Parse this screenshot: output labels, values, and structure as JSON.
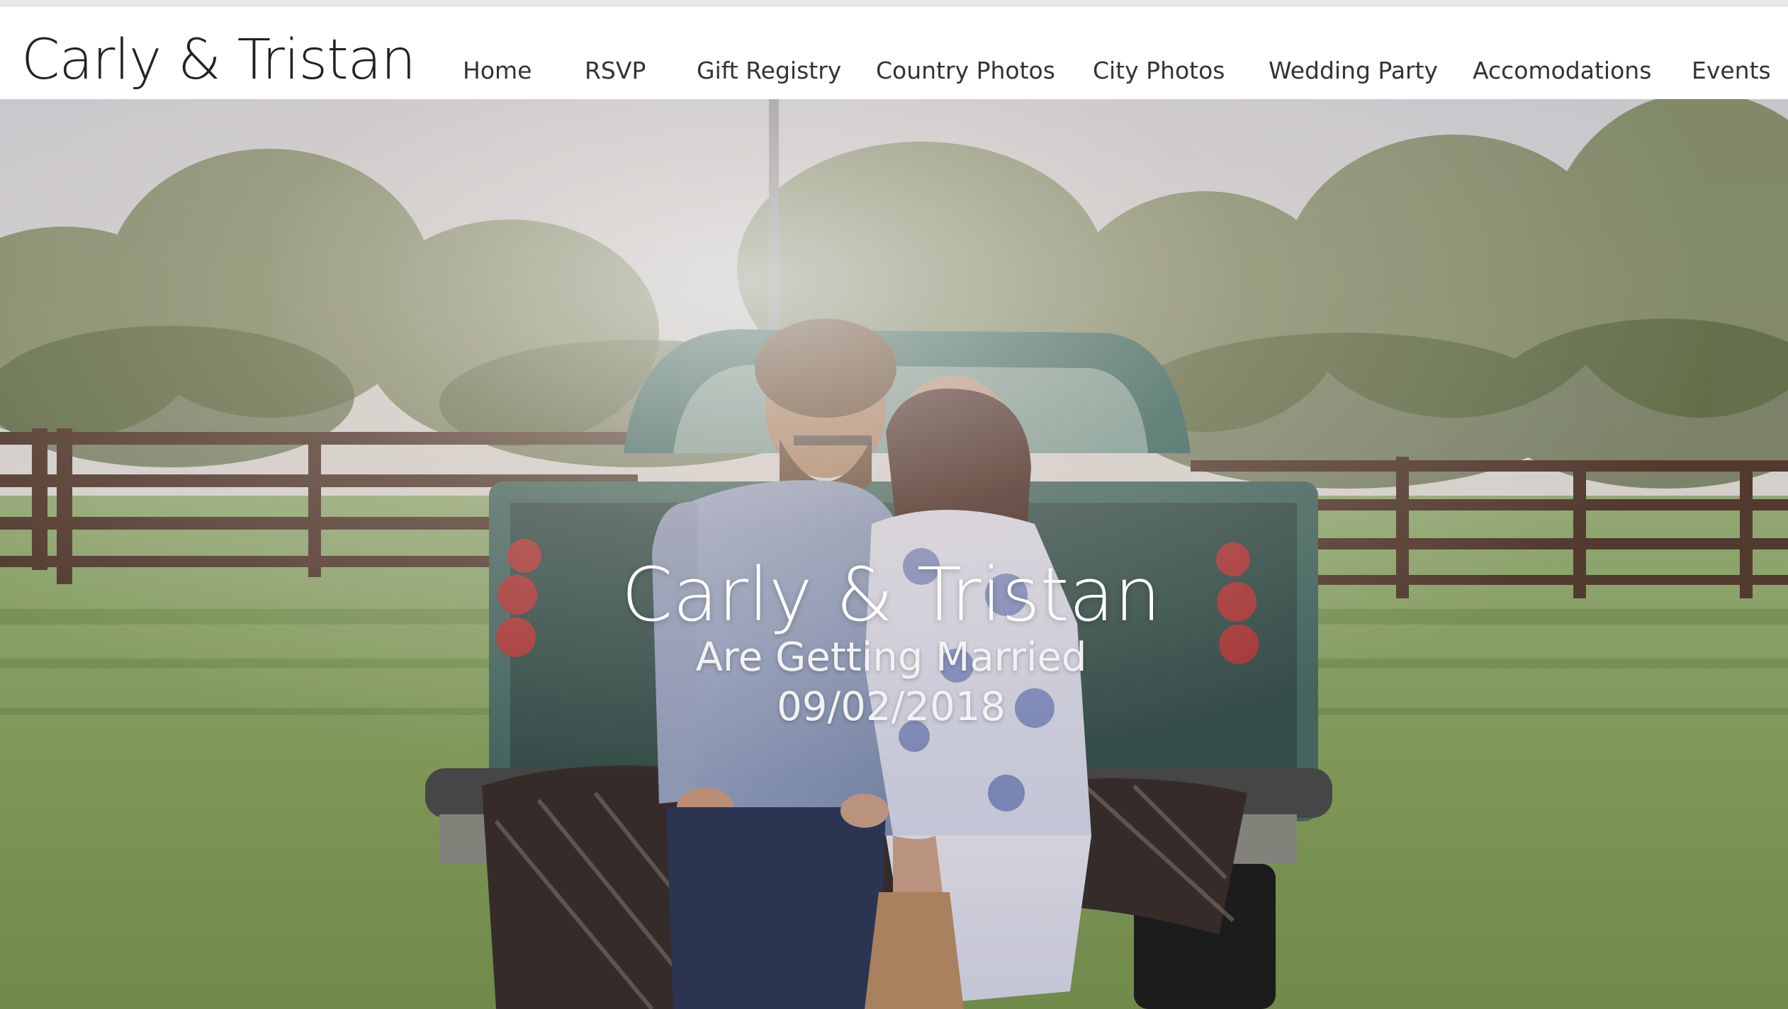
{
  "site": {
    "brand": "Carly & Tristan"
  },
  "nav": {
    "items": [
      {
        "label": "Home"
      },
      {
        "label": "RSVP"
      },
      {
        "label": "Gift Registry"
      },
      {
        "label": "Country Photos"
      },
      {
        "label": "City Photos"
      },
      {
        "label": "Wedding Party"
      },
      {
        "label": "Accomodations"
      },
      {
        "label": "Events"
      }
    ]
  },
  "hero": {
    "title": "Carly & Tristan",
    "subtitle": "Are Getting Married",
    "date": "09/02/2018",
    "image_icon": "couple-on-truck-tailgate-photo"
  },
  "colors": {
    "header_bg": "#ffffff",
    "brand_text": "#222222",
    "nav_text": "#333333",
    "hero_text": "#ffffff",
    "grass": "#8aa86a",
    "fence": "#5a3f33",
    "truck": "#3f6e66"
  }
}
